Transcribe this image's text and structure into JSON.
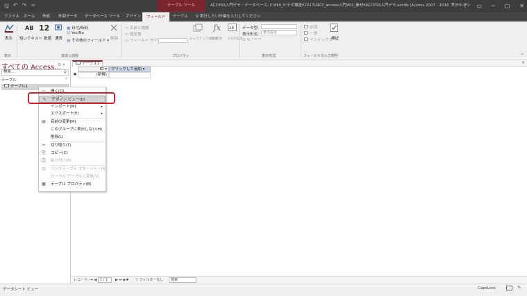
{
  "titlebar": {
    "qat": [
      "🖫",
      "↶",
      "↷",
      "="
    ],
    "context_tools": "テーブル ツール",
    "doc_title": "ACCESS入門デモ : データベース- C:¥14_ビデオ講座¥20170407_access入門¥02_素材¥ACCESS入門デモ.accdb (Access 2007 - 2016 ファイ…",
    "signin": "サインイン",
    "help": "?",
    "minimize": "─",
    "restore": "□",
    "close": "✕"
  },
  "tabs": {
    "file": "ファイル",
    "home": "ホーム",
    "create": "作成",
    "external": "外部データ",
    "dbtools": "データベース ツール",
    "addins": "アドイン",
    "fields": "フィールド",
    "table": "テーブル",
    "tell": "♀ 実行したい作業を入力してください"
  },
  "ribbon": {
    "view_label": "表示",
    "views_group": "表示",
    "ab_text": "AB",
    "short_text": "短いテキスト",
    "num12": "12",
    "number": "数値",
    "currency": "通貨",
    "datetime": "日付/時刻",
    "yesno": "Yes/No",
    "more_fields": "その他のフィールド",
    "delete": "削除",
    "add_delete_group": "追加と削除",
    "name_caption": "名前と標題",
    "default_value": "既定値",
    "field_size": "フィールド サイズ",
    "properties_group": "プロパティ",
    "lookup": "ルックアップの変更",
    "expression": "式の変更",
    "memo_settings": "メモの設定",
    "data_type": "データ型:",
    "format": "表示形式:",
    "format_value": "書式設定",
    "format_group": "表示形式",
    "required": "必須",
    "unique": "一意",
    "indexed": "インデックス",
    "validation": "検証",
    "validation_group": "フィールドの入力規則"
  },
  "navpane": {
    "title": "すべての Access...",
    "buttons": "⊙ «",
    "search_placeholder": "検索...",
    "group_label": "テーブル",
    "group_chevron": "☆",
    "item": "テーブル1"
  },
  "document": {
    "tab_label": "テーブル1",
    "close": "×",
    "col_id": "ID",
    "col_add": "クリックして追加",
    "new_record": "(新規)",
    "new_marker": "✱"
  },
  "context_menu": {
    "items": [
      {
        "icon": "▭",
        "label": "開く(O)",
        "arrow": ""
      },
      {
        "icon": "✎",
        "label": "デザイン ビュー(D)",
        "arrow": ""
      },
      {
        "icon": "",
        "label": "インポート(M)",
        "arrow": "▸"
      },
      {
        "icon": "",
        "label": "エクスポート(E)",
        "arrow": "▸"
      },
      {
        "icon": "▤",
        "label": "名前の変更(M)",
        "arrow": ""
      },
      {
        "icon": "",
        "label": "このグループに表示しない(H)",
        "arrow": ""
      },
      {
        "icon": "",
        "label": "削除(L)",
        "arrow": ""
      },
      {
        "icon": "✂",
        "label": "切り取り(T)",
        "arrow": ""
      },
      {
        "icon": "⎘",
        "label": "コピー(C)",
        "arrow": ""
      },
      {
        "icon": "📋",
        "label": "貼り付け(P)",
        "arrow": ""
      },
      {
        "icon": "▥",
        "label": "リンクテーブル マネージャー(K)",
        "arrow": ""
      },
      {
        "icon": "",
        "label": "ローカル テーブルに変換(V)",
        "arrow": ""
      },
      {
        "icon": "▦",
        "label": "テーブル プロパティ(B)",
        "arrow": ""
      }
    ]
  },
  "record_nav": {
    "label": "レコード: ⏮ ◀",
    "position": "1 / 1",
    "next": "▶ ⏭ ▶✱",
    "filter": "▽ フィルターなし",
    "search": "検索"
  },
  "statusbar": {
    "left": "データシート ビュー",
    "caps": "CapsLock"
  },
  "colors": {
    "access_red": "#8a1d2a",
    "highlight_box": "#d9202a"
  }
}
